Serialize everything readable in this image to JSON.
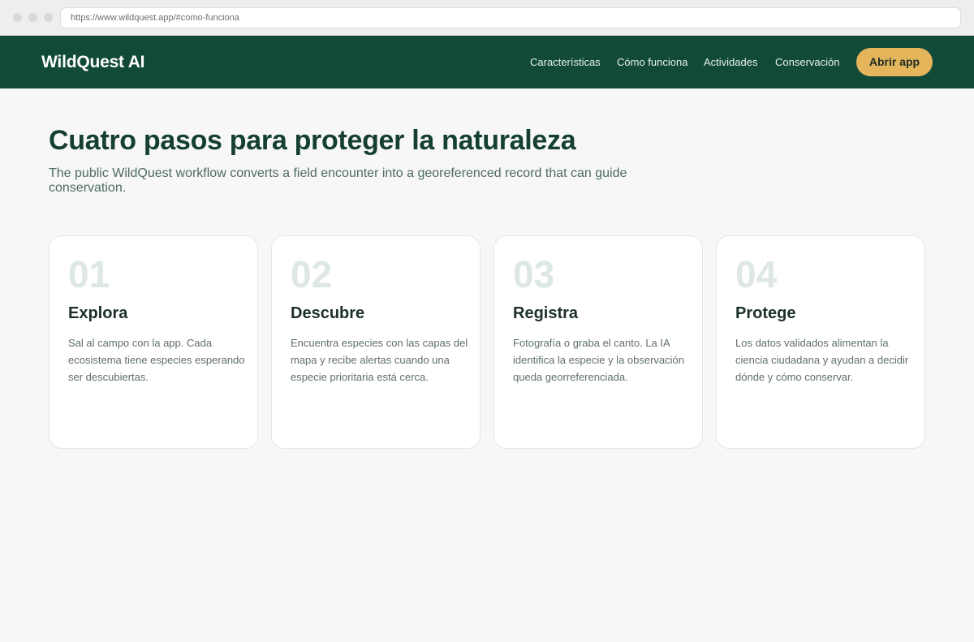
{
  "browser": {
    "url": "https://www.wildquest.app/#como-funciona"
  },
  "nav": {
    "brand": "WildQuest AI",
    "links": [
      "Características",
      "Cómo funciona",
      "Actividades",
      "Conservación"
    ],
    "cta": "Abrir app"
  },
  "main": {
    "title": "Cuatro pasos para proteger la naturaleza",
    "subtitle": "The public WildQuest workflow converts a field encounter into a georeferenced record that can guide conservation.",
    "steps": [
      {
        "number": "01",
        "title": "Explora",
        "text": "Sal al campo con la app. Cada ecosistema tiene especies esperando ser descubiertas."
      },
      {
        "number": "02",
        "title": "Descubre",
        "text": "Encuentra especies con las capas del mapa y recibe alertas cuando una especie prioritaria está cerca."
      },
      {
        "number": "03",
        "title": "Registra",
        "text": "Fotografía o graba el canto. La IA identifica la especie y la observación queda georreferenciada."
      },
      {
        "number": "04",
        "title": "Protege",
        "text": "Los datos validados alimentan la ciencia ciudadana y ayudan a decidir dónde y cómo conservar."
      }
    ]
  },
  "colors": {
    "nav_bg": "#124a3a",
    "accent": "#e5b55c",
    "title": "#153f33"
  }
}
